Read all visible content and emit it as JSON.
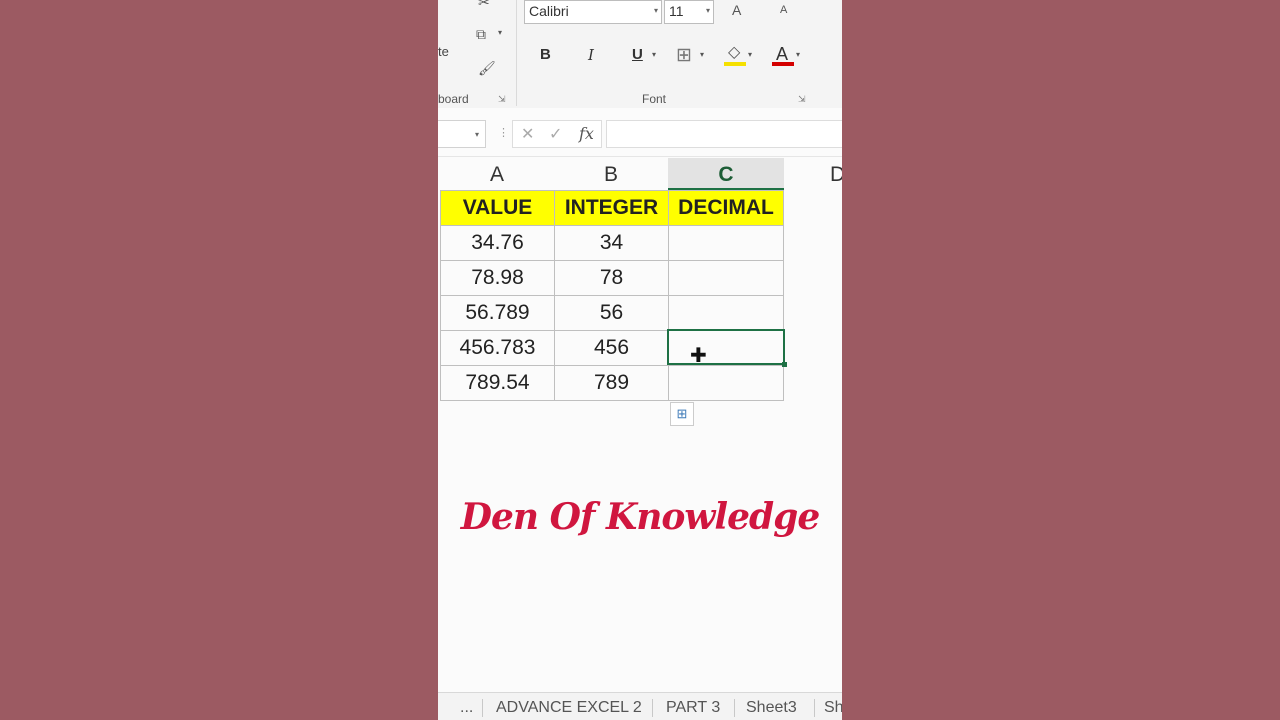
{
  "ribbon": {
    "paste_label": "te",
    "clipboard_label": "board",
    "font_group_label": "Font",
    "font_name": "Calibri",
    "font_size": "11",
    "grow_font": "A",
    "shrink_font": "A",
    "bold": "B",
    "italic": "I",
    "underline": "U",
    "font_color_letter": "A",
    "highlight_color": "#f5e000",
    "font_color": "#d40000"
  },
  "formula_bar": {
    "fx": "fx",
    "cancel": "✕",
    "enter": "✓",
    "value": ""
  },
  "columns": [
    "A",
    "B",
    "C",
    "D"
  ],
  "table": {
    "headers": [
      "VALUE",
      "INTEGER",
      "DECIMAL"
    ],
    "rows": [
      [
        "34.76",
        "34",
        ""
      ],
      [
        "78.98",
        "78",
        ""
      ],
      [
        "56.789",
        "56",
        ""
      ],
      [
        "456.783",
        "456",
        ""
      ],
      [
        "789.54",
        "789",
        ""
      ]
    ]
  },
  "watermark": "Den Of Knowledge",
  "sheet_tabs": {
    "more": "...",
    "tabs": [
      "ADVANCE EXCEL 2",
      "PART 3",
      "Sheet3",
      "Sh"
    ]
  },
  "colors": {
    "header_fill": "#ffff00",
    "selection": "#1e7145",
    "background": "#9c5a62",
    "watermark": "#d0163f"
  }
}
